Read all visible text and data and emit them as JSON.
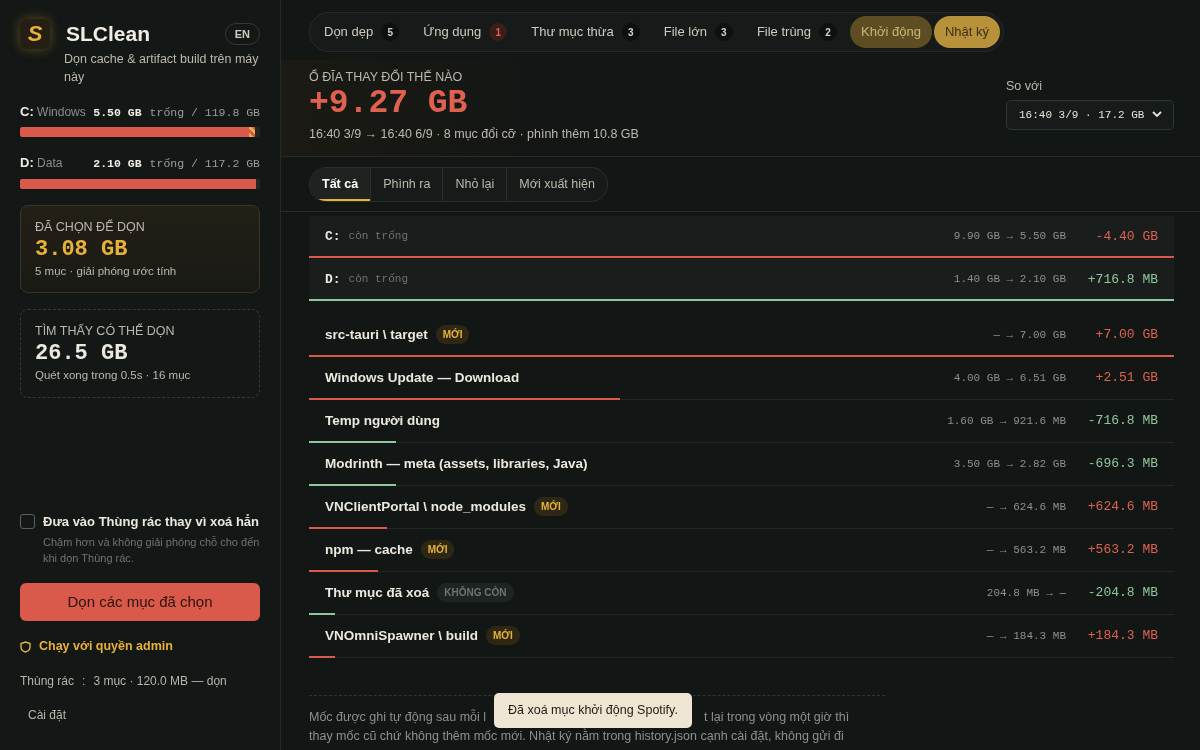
{
  "sidebar": {
    "logo_letter": "S",
    "app_name": "SLClean",
    "language_button": "EN",
    "tagline": "Dọn cache & artifact build trên máy này",
    "drives": [
      {
        "letter": "C:",
        "label": "Windows",
        "free": "5.50 GB",
        "rest": "trống / 119.8 GB",
        "level": 0.955,
        "pending": true
      },
      {
        "letter": "D:",
        "label": "Data",
        "free": "2.10 GB",
        "rest": "trống / 117.2 GB",
        "level": 0.985
      }
    ],
    "selected_card": {
      "label": "ĐÃ CHỌN ĐỂ DỌN",
      "value": "3.08 GB",
      "detail": "5 mục · giải phóng ước tính"
    },
    "found_card": {
      "label": "TÌM THẤY CÓ THỂ DỌN",
      "value": "26.5 GB",
      "detail": "Quét xong trong 0.5s · 16 mục"
    },
    "recycle_option": {
      "label": "Đưa vào Thùng rác thay vì xoá hẳn",
      "hint": "Chậm hơn và không giải phóng chỗ cho đến khi dọn Thùng rác.",
      "checked": false
    },
    "clean_button": "Dọn các mục đã chọn",
    "admin_link": "Chạy với quyền admin",
    "trash": {
      "label": "Thùng rác",
      "separator": ":",
      "value": "3 mục · 120.0 MB — dọn"
    },
    "settings_link": "Cài đặt"
  },
  "nav_tabs": [
    {
      "kind": "tab",
      "label": "Dọn dẹp",
      "count": "5",
      "alert": false,
      "selected": false
    },
    {
      "kind": "tab",
      "label": "Ứng dụng",
      "count": "1",
      "alert": true,
      "selected": false
    },
    {
      "kind": "tab",
      "label": "Thư mục thừa",
      "count": "3",
      "alert": false,
      "selected": false
    },
    {
      "kind": "tab",
      "label": "File lớn",
      "count": "3",
      "alert": false,
      "selected": false
    },
    {
      "kind": "tab",
      "label": "File trùng",
      "count": "2",
      "alert": false,
      "selected": false
    },
    {
      "kind": "pill",
      "label": "Khởi động",
      "selected": false
    },
    {
      "kind": "pill",
      "label": "Nhật ký",
      "selected": true
    }
  ],
  "summary": {
    "label": "Ổ ĐĨA THAY ĐỔI THẾ NÀO",
    "value": "+9.27 GB",
    "detail": "16:40 3/9 → 16:40 6/9 · 8 mục đổi cỡ · phình thêm 10.8 GB",
    "compare_label": "So với",
    "compare_value": "16:40 3/9 · 17.2 GB"
  },
  "filters": [
    {
      "label": "Tất cả",
      "selected": true
    },
    {
      "label": "Phình ra",
      "selected": false
    },
    {
      "label": "Nhỏ lại",
      "selected": false
    },
    {
      "label": "Mới xuất hiện",
      "selected": false
    }
  ],
  "drive_rows": [
    {
      "name": "C:",
      "note": "còn trống",
      "change": "9.90 GB → 5.50 GB",
      "delta": "-4.40 GB",
      "good": false,
      "level": 1
    },
    {
      "name": "D:",
      "note": "còn trống",
      "change": "1.40 GB → 2.10 GB",
      "delta": "+716.8 MB",
      "good": true,
      "level": 1
    }
  ],
  "rows": [
    {
      "name": "src-tauri \\ target",
      "badge": {
        "kind": "new",
        "text": "MỚI"
      },
      "change": "— → 7.00 GB",
      "delta": "+7.00 GB",
      "good": false,
      "level": 1
    },
    {
      "name": "Windows Update — Download",
      "change": "4.00 GB → 6.51 GB",
      "delta": "+2.51 GB",
      "good": false,
      "level": 0.36
    },
    {
      "name": "Temp người dùng",
      "change": "1.60 GB → 921.6 MB",
      "delta": "-716.8 MB",
      "good": true,
      "level": 0.1
    },
    {
      "name": "Modrinth — meta (assets, libraries, Java)",
      "change": "3.50 GB → 2.82 GB",
      "delta": "-696.3 MB",
      "good": true,
      "level": 0.1
    },
    {
      "name": "VNClientPortal \\ node_modules",
      "badge": {
        "kind": "new",
        "text": "MỚI"
      },
      "change": "— → 624.6 MB",
      "delta": "+624.6 MB",
      "good": false,
      "level": 0.09
    },
    {
      "name": "npm — cache",
      "badge": {
        "kind": "new",
        "text": "MỚI"
      },
      "change": "— → 563.2 MB",
      "delta": "+563.2 MB",
      "good": false,
      "level": 0.08
    },
    {
      "name": "Thư mục đã xoá",
      "badge": {
        "kind": "gone",
        "text": "KHÔNG CÒN"
      },
      "change": "204.8 MB → —",
      "delta": "-204.8 MB",
      "good": true,
      "level": 0.03
    },
    {
      "name": "VNOmniSpawner \\ build",
      "badge": {
        "kind": "new",
        "text": "MỚI"
      },
      "change": "— → 184.3 MB",
      "delta": "+184.3 MB",
      "good": false,
      "level": 0.03
    }
  ],
  "note": {
    "line_1_start": "Mốc được ghi tự động sau mỗi l",
    "line_1_end": "t lại trong vòng một giờ thì",
    "line_2": "thay mốc cũ chứ không thêm mốc mới. Nhật ký nằm trong history.json cạnh cài đặt, không gửi đi"
  },
  "toast": "Đã xoá mục khởi động Spotify."
}
